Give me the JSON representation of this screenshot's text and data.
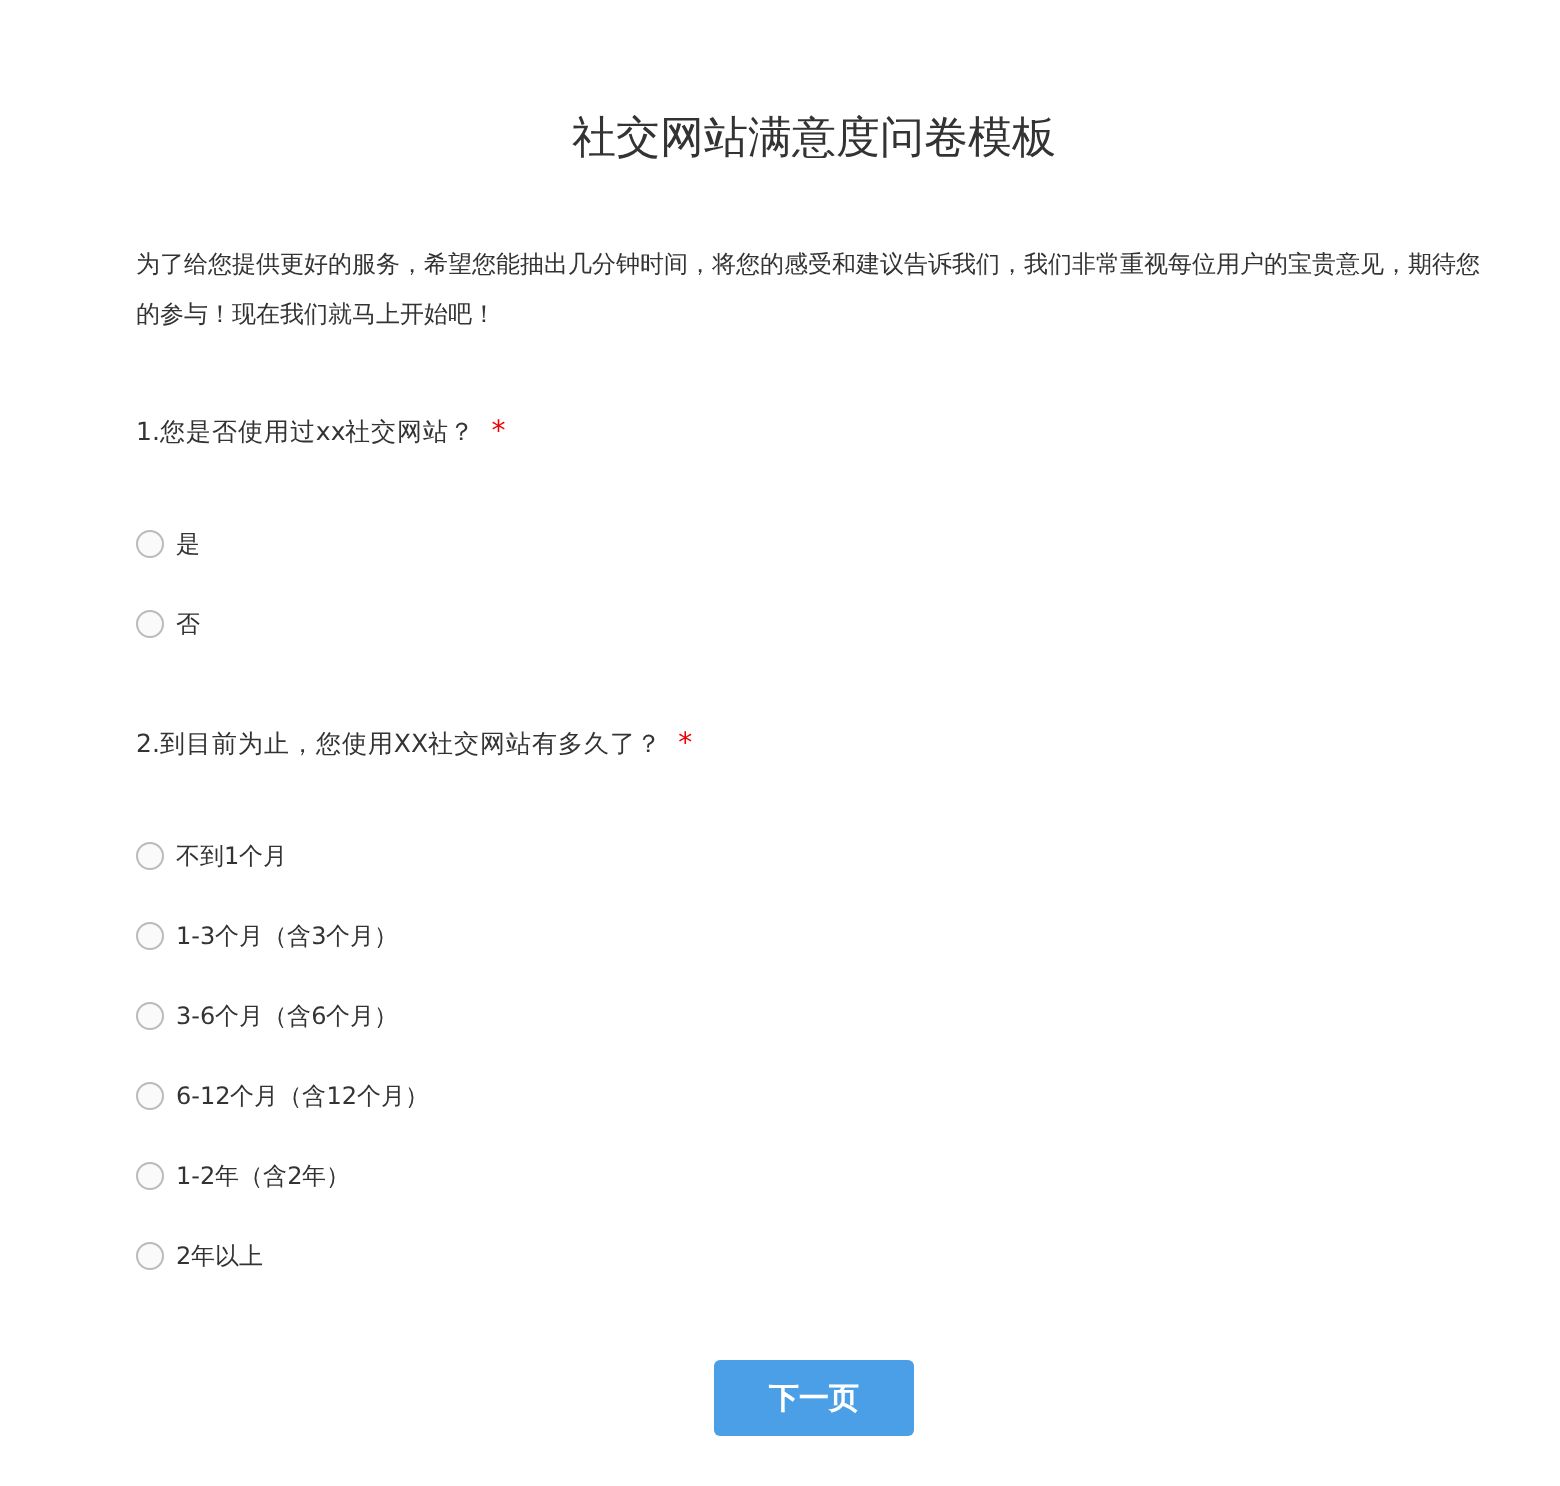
{
  "title": "社交网站满意度问卷模板",
  "intro": "为了给您提供更好的服务，希望您能抽出几分钟时间，将您的感受和建议告诉我们，我们非常重视每位用户的宝贵意见，期待您的参与！现在我们就马上开始吧！",
  "questions": [
    {
      "text": "1.您是否使用过xx社交网站？",
      "required_mark": "*",
      "options": [
        {
          "label": "是",
          "selected": false
        },
        {
          "label": "否",
          "selected": false
        }
      ]
    },
    {
      "text": "2.到目前为止，您使用XX社交网站有多久了？",
      "required_mark": "*",
      "options": [
        {
          "label": "不到1个月",
          "selected": false
        },
        {
          "label": "1-3个月（含3个月）",
          "selected": false
        },
        {
          "label": "3-6个月（含6个月）",
          "selected": false
        },
        {
          "label": "6-12个月（含12个月）",
          "selected": false
        },
        {
          "label": "1-2年（含2年）",
          "selected": false
        },
        {
          "label": "2年以上",
          "selected": false
        }
      ]
    }
  ],
  "next_button": "下一页"
}
